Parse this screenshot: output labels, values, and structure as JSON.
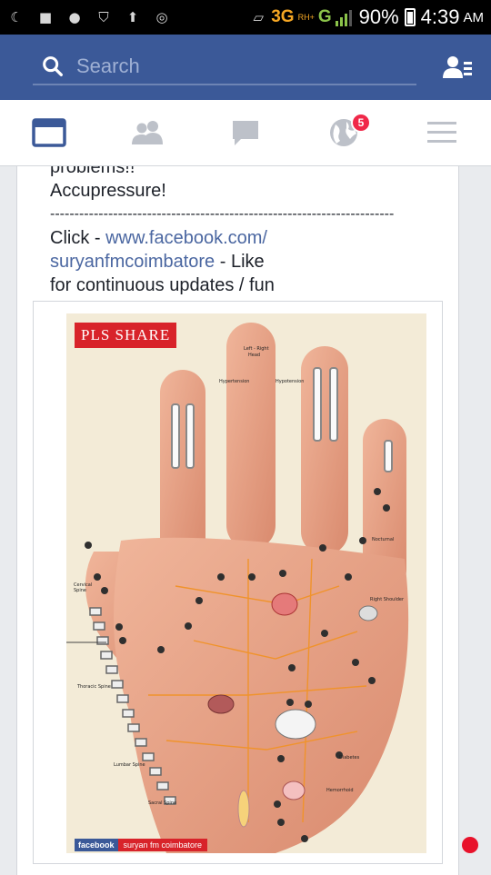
{
  "status_bar": {
    "net_3g": "3G",
    "net_rh": "RH+",
    "net_g": "G",
    "battery": "90%",
    "time": "4:39",
    "ampm": "AM"
  },
  "header": {
    "search_placeholder": "Search"
  },
  "nav": {
    "notifications_badge": "5"
  },
  "post": {
    "line1": "problems!!",
    "line2": "Accupressure!",
    "divider": "-----------------------------------------------------------------------",
    "click_prefix": "Click - ",
    "link_line1": "www.facebook.com/",
    "link_line2": "suryanfmcoimbatore",
    "link_suffix": " - Like",
    "line_last": "for continuous updates / fun"
  },
  "photo": {
    "banner": "PLS SHARE",
    "footer_brand": "facebook",
    "footer_page": "suryan fm coimbatore"
  },
  "colors": {
    "header_blue": "#3b5998",
    "link_blue": "#4b67a1",
    "badge_red": "#f02849",
    "banner_red": "#d8232a"
  }
}
